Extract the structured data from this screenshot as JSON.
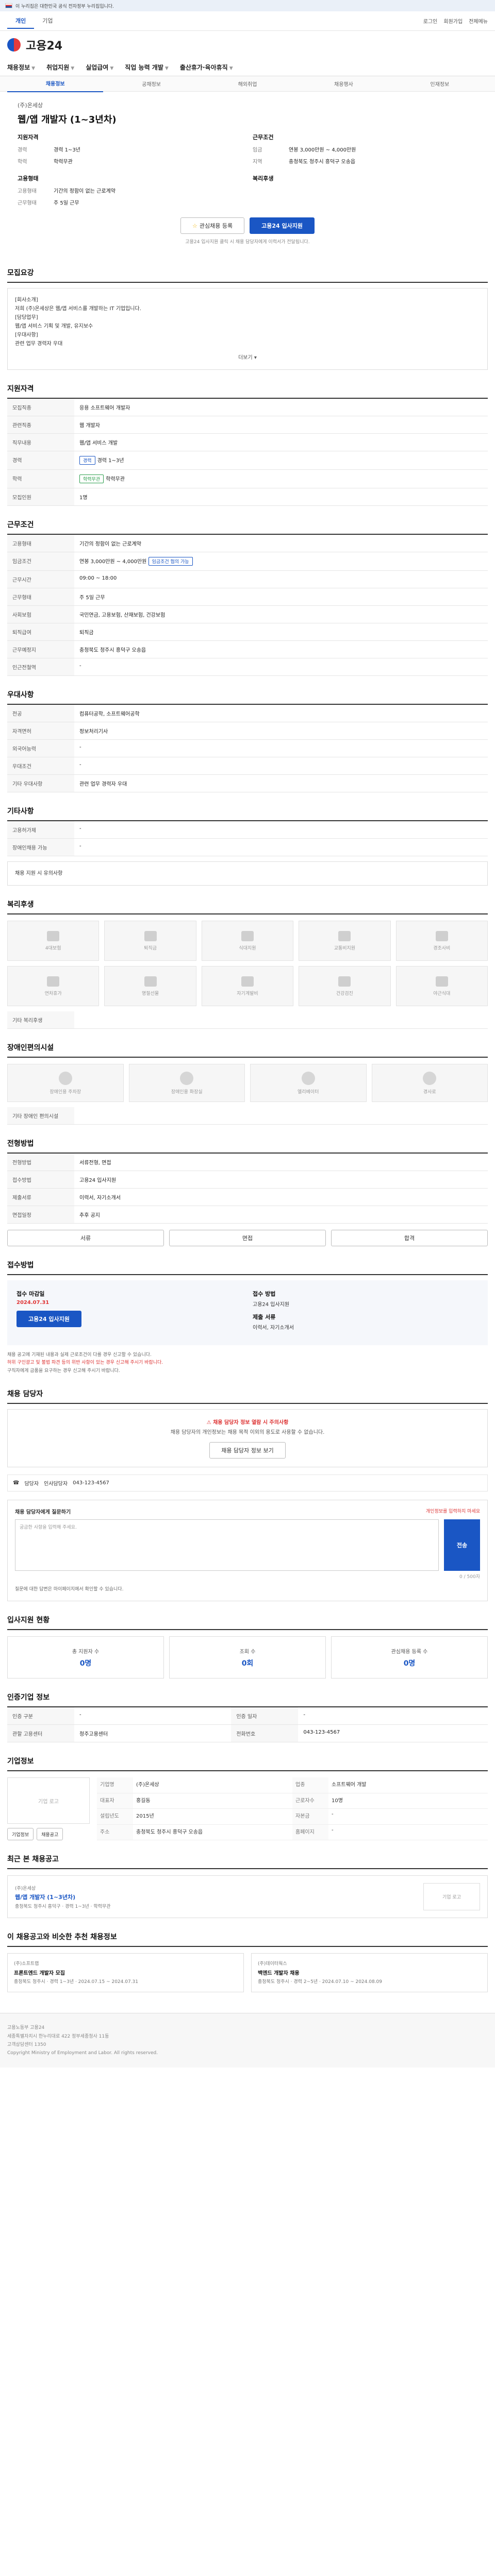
{
  "gov": {
    "text": "이 누리집은 대한민국 공식 전자정부 누리집입니다."
  },
  "topbar": {
    "tabs": [
      "개인",
      "기업"
    ],
    "right": [
      "로그인",
      "회원가입",
      "전체메뉴"
    ]
  },
  "logo": {
    "text": "고용24"
  },
  "nav": {
    "items": [
      "채용정보",
      "취업지원",
      "실업급여",
      "직업 능력 개발",
      "출산휴가·육아휴직"
    ]
  },
  "subnav": {
    "items": [
      "채용정보",
      "공채정보",
      "해외취업",
      "채용행사",
      "인재정보"
    ]
  },
  "hero": {
    "company": "(주)온세상",
    "title": "웹/앱 개발자 (1~3년차)",
    "recruit_title": "지원자격",
    "work_title": "근무조건",
    "recruit": [
      {
        "k": "경력",
        "v": "경력 1~3년"
      },
      {
        "k": "학력",
        "v": "학력무관"
      }
    ],
    "work": [
      {
        "k": "임금",
        "v": "연봉 3,000만원 ~ 4,000만원"
      },
      {
        "k": "지역",
        "v": "충청북도 청주시 흥덕구 오송읍"
      }
    ],
    "type_title": "고용형태",
    "type_rows": [
      {
        "k": "고용형태",
        "v": "기간의 정함이 없는 근로계약"
      },
      {
        "k": "근무형태",
        "v": "주 5일 근무"
      }
    ],
    "welfare_title": "복리후생",
    "scrap_label": "관심채용 등록",
    "apply_label": "고용24 입사지원",
    "notice": "고용24 입사지원 클릭 시 채용 담당자에게 이력서가 전달됩니다."
  },
  "detail": {
    "title": "모집요강",
    "body_lines": [
      "[회사소개]",
      "저희 (주)온세상은 웹/앱 서비스를 개발하는 IT 기업입니다.",
      "[담당업무]",
      "웹/앱 서비스 기획 및 개발, 유지보수",
      "[우대사항]",
      "관련 업무 경력자 우대"
    ],
    "more_label": "더보기"
  },
  "recruit_cond": {
    "title": "지원자격",
    "rows": [
      {
        "k": "모집직종",
        "v": "응용 소프트웨어 개발자"
      },
      {
        "k": "관련직종",
        "v": "웹 개발자"
      },
      {
        "k": "직무내용",
        "v": "웹/앱 서비스 개발"
      },
      {
        "k": "경력",
        "v": "경력 1~3년"
      },
      {
        "k": "학력",
        "v": "학력무관"
      },
      {
        "k": "모집인원",
        "v": "1명"
      }
    ],
    "tags": [
      "학력무관",
      "경력"
    ]
  },
  "work_cond": {
    "title": "근무조건",
    "rows": [
      {
        "k": "고용형태",
        "v": "기간의 정함이 없는 근로계약"
      },
      {
        "k": "임금조건",
        "v": "연봉 3,000만원 ~ 4,000만원"
      },
      {
        "k": "근무시간",
        "v": "09:00 ~ 18:00"
      },
      {
        "k": "근무형태",
        "v": "주 5일 근무"
      },
      {
        "k": "사회보험",
        "v": "국민연금, 고용보험, 산재보험, 건강보험"
      },
      {
        "k": "퇴직급여",
        "v": "퇴직금"
      },
      {
        "k": "근무예정지",
        "v": "충청북도 청주시 흥덕구 오송읍"
      },
      {
        "k": "인근전철역",
        "v": "-"
      }
    ],
    "tag": "임금조건 협의 가능"
  },
  "prefer": {
    "title": "우대사항",
    "rows": [
      {
        "k": "전공",
        "v": "컴퓨터공학, 소프트웨어공학"
      },
      {
        "k": "자격면허",
        "v": "정보처리기사"
      },
      {
        "k": "외국어능력",
        "v": "-"
      },
      {
        "k": "우대조건",
        "v": "-"
      },
      {
        "k": "기타 우대사항",
        "v": "관련 업무 경력자 우대"
      }
    ]
  },
  "other": {
    "title": "기타사항",
    "rows": [
      {
        "k": "고용허가제",
        "v": "-"
      },
      {
        "k": "장애인채용 가능",
        "v": "-"
      }
    ],
    "extra": "채용 지원 시 유의사항"
  },
  "welfare": {
    "title": "복리후생",
    "items": [
      "4대보험",
      "퇴직금",
      "식대지원",
      "교통비지원",
      "경조사비",
      "연차휴가",
      "명절선물",
      "자기계발비",
      "건강검진",
      "야근식대"
    ],
    "note": "기타 복리후생"
  },
  "facility": {
    "title": "장애인편의시설",
    "items": [
      "장애인용 주차장",
      "장애인용 화장실",
      "엘리베이터",
      "경사로"
    ],
    "note": "기타 장애인 편의시설"
  },
  "selection": {
    "title": "전형방법",
    "rows": [
      {
        "k": "전형방법",
        "v": "서류전형, 면접"
      },
      {
        "k": "접수방법",
        "v": "고용24 입사지원"
      },
      {
        "k": "제출서류",
        "v": "이력서, 자기소개서"
      },
      {
        "k": "면접일정",
        "v": "추후 공지"
      }
    ],
    "btns": [
      "서류",
      "면접",
      "합격"
    ]
  },
  "apply": {
    "title": "접수방법",
    "period_label": "접수 마감일",
    "period": "2024.07.31",
    "method_label": "접수 방법",
    "method": "고용24 입사지원",
    "docs_label": "제출 서류",
    "docs": "이력서, 자기소개서",
    "btn": "고용24 입사지원",
    "notes": [
      "채용 공고에 기재된 내용과 실제 근로조건이 다를 경우 신고할 수 있습니다.",
      "허위 구인광고 및 불법 파견 등의 위반 사항이 있는 경우 신고해 주시기 바랍니다.",
      "구직자에게 금품을 요구하는 경우 신고해 주시기 바랍니다."
    ]
  },
  "contact": {
    "title": "채용 담당자",
    "warn": "채용 담당자 정보 열람 시 주의사항",
    "desc": "채용 담당자의 개인정보는 채용 목적 이외의 용도로 사용할 수 없습니다.",
    "btn": "채용 담당자 정보 보기",
    "row_label": "담당자",
    "row_value": "인사담당자",
    "row_phone": "043-123-4567"
  },
  "qa": {
    "title": "채용 담당자에게 질문하기",
    "hint": "개인정보를 입력하지 마세요",
    "placeholder": "궁금한 사항을 입력해 주세요.",
    "send": "전송",
    "count": "0 / 500자",
    "note": "질문에 대한 답변은 마이페이지에서 확인할 수 있습니다."
  },
  "stats": {
    "title": "입사지원 현황",
    "items": [
      {
        "label": "총 지원자 수",
        "num": "0명"
      },
      {
        "label": "조회 수",
        "num": "0회"
      },
      {
        "label": "관심채용 등록 수",
        "num": "0명"
      }
    ]
  },
  "agency": {
    "title": "인증기업 정보",
    "rows": [
      {
        "k": "인증 구분",
        "v": "-"
      },
      {
        "k": "인증 일자",
        "v": "-"
      },
      {
        "k": "관할 고용센터",
        "v": "청주고용센터"
      },
      {
        "k": "전화번호",
        "v": "043-123-4567"
      }
    ]
  },
  "company": {
    "title": "기업정보",
    "logo": "기업 로고",
    "btns": [
      "기업정보",
      "채용공고"
    ],
    "rows": [
      {
        "k": "기업명",
        "v": "(주)온세상"
      },
      {
        "k": "업종",
        "v": "소프트웨어 개발"
      },
      {
        "k": "대표자",
        "v": "홍길동"
      },
      {
        "k": "근로자수",
        "v": "10명"
      },
      {
        "k": "설립년도",
        "v": "2015년"
      },
      {
        "k": "자본금",
        "v": "-"
      },
      {
        "k": "주소",
        "v": "충청북도 청주시 흥덕구 오송읍"
      },
      {
        "k": "홈페이지",
        "v": "-"
      }
    ]
  },
  "recent": {
    "title": "최근 본 채용공고",
    "item_title": "웹/앱 개발자 (1~3년차)",
    "item_company": "(주)온세상",
    "item_meta": "충청북도 청주시 흥덕구 · 경력 1~3년 · 학력무관",
    "thumb": "기업 로고"
  },
  "rec": {
    "title": "이 채용공고와 비슷한 추천 채용정보",
    "cards": [
      {
        "co": "(주)소프트랩",
        "ti": "프론트엔드 개발자 모집",
        "meta": "충청북도 청주시 · 경력 1~3년 · 2024.07.15 ~ 2024.07.31"
      },
      {
        "co": "(주)데이터웍스",
        "ti": "백엔드 개발자 채용",
        "meta": "충청북도 청주시 · 경력 2~5년 · 2024.07.10 ~ 2024.08.09"
      }
    ]
  },
  "footer": {
    "lines": [
      "고용노동부 고용24",
      "세종특별자치시 한누리대로 422 정부세종청사 11동",
      "고객상담센터 1350",
      "Copyright Ministry of Employment and Labor. All rights reserved."
    ]
  }
}
